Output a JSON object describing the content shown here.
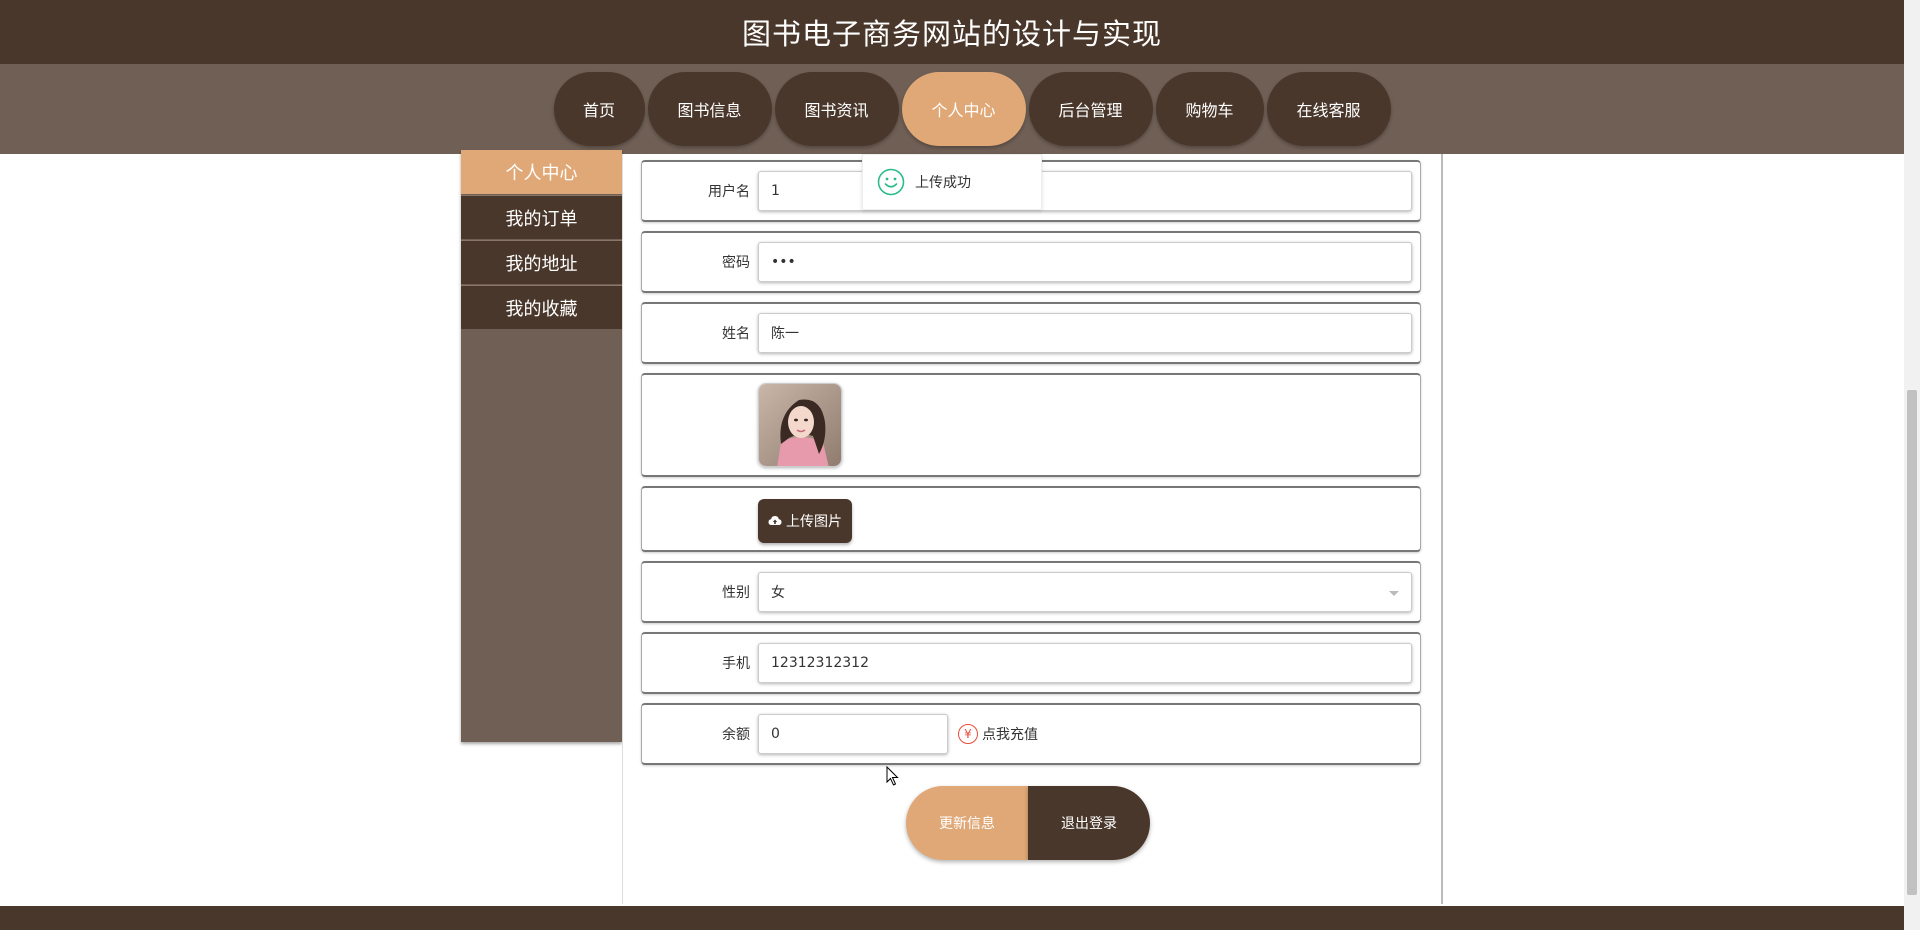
{
  "header": {
    "title": "图书电子商务网站的设计与实现"
  },
  "nav": {
    "items": [
      {
        "label": "首页",
        "active": false
      },
      {
        "label": "图书信息",
        "active": false
      },
      {
        "label": "图书资讯",
        "active": false
      },
      {
        "label": "个人中心",
        "active": true
      },
      {
        "label": "后台管理",
        "active": false
      },
      {
        "label": "购物车",
        "active": false
      },
      {
        "label": "在线客服",
        "active": false
      }
    ]
  },
  "sidebar": {
    "items": [
      {
        "label": "个人中心",
        "active": true
      },
      {
        "label": "我的订单",
        "active": false
      },
      {
        "label": "我的地址",
        "active": false
      },
      {
        "label": "我的收藏",
        "active": false
      }
    ]
  },
  "form": {
    "username": {
      "label": "用户名",
      "value": "1"
    },
    "password": {
      "label": "密码",
      "value": "•••"
    },
    "name": {
      "label": "姓名",
      "value": "陈一"
    },
    "upload_label": "上传图片",
    "gender": {
      "label": "性别",
      "value": "女"
    },
    "phone": {
      "label": "手机",
      "value": "12312312312"
    },
    "balance": {
      "label": "余额",
      "value": "0",
      "recharge_label": "点我充值",
      "yen_symbol": "¥"
    }
  },
  "actions": {
    "update_label": "更新信息",
    "logout_label": "退出登录"
  },
  "toast": {
    "message": "上传成功"
  },
  "colors": {
    "brand_dark": "#4a372b",
    "brand_mid": "#6f5f55",
    "accent": "#e0a877",
    "success": "#2dbb8c",
    "danger": "#e74c3c"
  }
}
